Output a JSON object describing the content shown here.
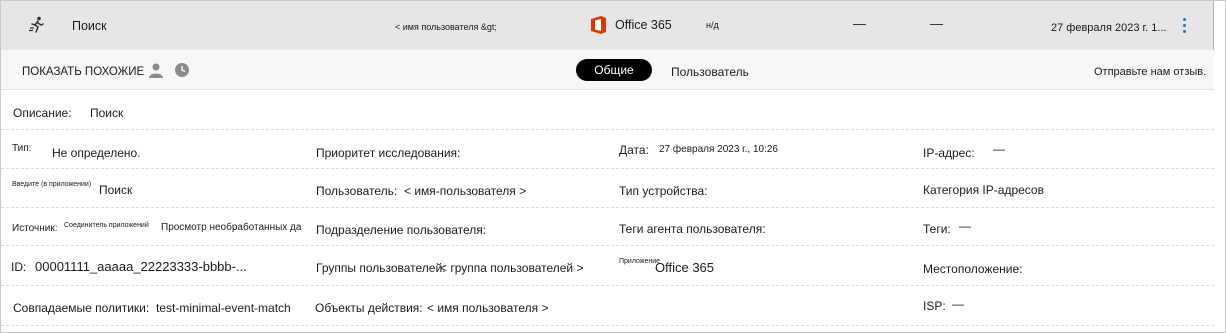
{
  "header": {
    "activity": "Поиск",
    "user": "< имя пользователя &gt;",
    "app": "Office 365",
    "na": "н/д",
    "dash1": "—",
    "dash2": "—",
    "date": "27 февраля 2023 г. 1..."
  },
  "toolbar": {
    "show_similar": "ПОКАЗАТЬ ПОХОЖИЕ",
    "tabs": [
      "Общие",
      "Пользователь"
    ],
    "feedback": "Отправьте нам отзыв."
  },
  "details": {
    "description_label": "Описание:",
    "description_value": "Поиск",
    "type_label": "Тип:",
    "type_value": "Не определено.",
    "priority_label": "Приоритет исследования:",
    "date_label": "Дата:",
    "date_value": "27 февраля 2023 г., 10:26",
    "ip_label": "IP-адрес:",
    "ip_value": "—",
    "entered_label": "Введите (в приложении)",
    "entered_value": "Поиск",
    "user_label": "Пользователь:",
    "user_value": "< имя-пользователя >",
    "device_label": "Тип устройства:",
    "ip_category_label": "Категория IP-адресов",
    "source_label": "Источник:",
    "source_value": "Соединитель приложений",
    "raw_data_link": "Просмотр необработанных данных",
    "dept_label": "Подразделение пользователя:",
    "agent_tags_label": "Теги агента пользователя:",
    "tags_label": "Теги:",
    "tags_value": "—",
    "id_label": "ID:",
    "id_value": "00001111_aaaaa_22223333-bbbb-...",
    "groups_label": "Группы пользователей:",
    "groups_value": "< группа пользователей >",
    "app_label": "Приложение",
    "app_value": "Office 365",
    "location_label": "Местоположение:",
    "policies_label": "Совпадаемые политики:",
    "policies_value": "test-minimal-event-match",
    "objects_label": "Объекты действия:",
    "objects_value": "< имя пользователя >",
    "isp_label": "ISP:",
    "isp_value": "—"
  },
  "colors": {
    "accent": "#2b6cc4",
    "office": "#d83b01",
    "tab_active_bg": "#000000"
  },
  "icons": [
    "activity-icon",
    "office-icon",
    "more-icon",
    "person-icon",
    "clock-icon"
  ]
}
